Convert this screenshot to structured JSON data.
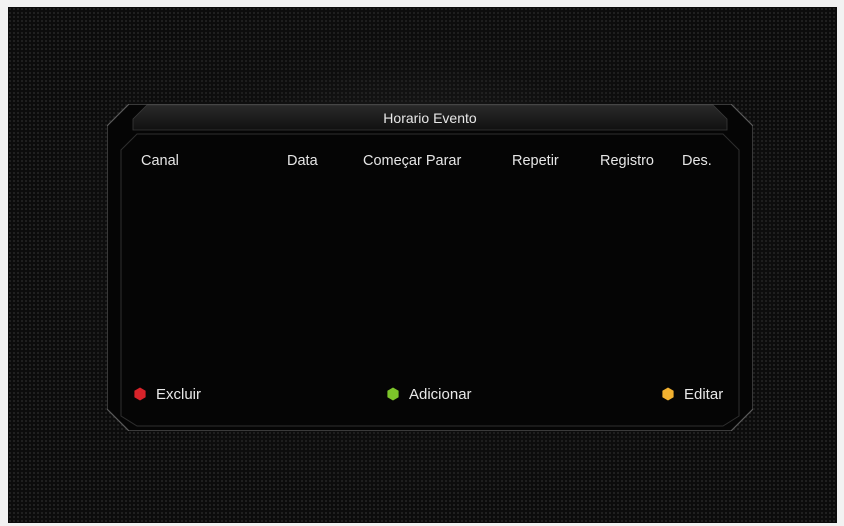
{
  "dialog": {
    "title": "Horario Evento"
  },
  "columns": [
    "Canal",
    "Data",
    "Começar Parar",
    "Repetir",
    "Registro",
    "Des."
  ],
  "rows": [],
  "buttons": {
    "delete": {
      "label": "Excluir",
      "color_key": "red",
      "icon": "red-hexagon-icon"
    },
    "add": {
      "label": "Adicionar",
      "color_key": "green",
      "icon": "green-hexagon-icon"
    },
    "edit": {
      "label": "Editar",
      "color_key": "yellow",
      "icon": "yellow-hexagon-icon"
    }
  },
  "colors": {
    "red": "#d8232a",
    "green": "#7cc42a",
    "yellow": "#f2b130",
    "text": "#e8e8e8",
    "background": "#0c0c0c"
  }
}
